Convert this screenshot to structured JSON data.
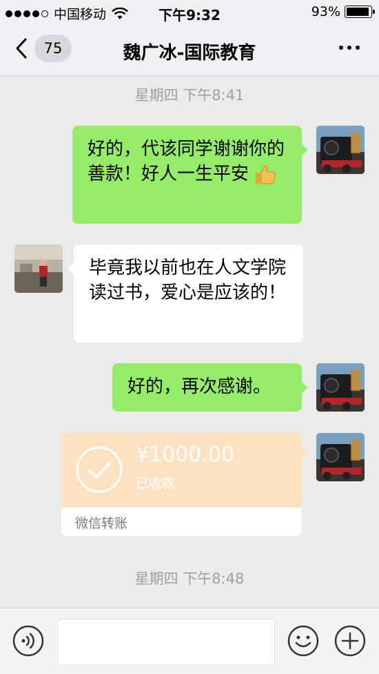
{
  "status_bar": {
    "carrier": "中国移动",
    "time": "下午9:32",
    "battery": "93%",
    "battery_level": 0.93
  },
  "nav": {
    "back_count": "75",
    "title": "魏广冰-国际教育"
  },
  "messages": {
    "time1": "星期四 下午8:41",
    "msg1": "好的，代该同学谢谢你的善款！好人一生平安",
    "msg2": "毕竟我以前也在人文学院读过书，爱心是应该的！",
    "msg3": "好的，再次感谢。",
    "transfer_amount": "¥1000.00",
    "transfer_status": "已收款",
    "transfer_label": "微信转账",
    "time2": "星期四 下午8:48"
  },
  "input": {
    "value": ""
  },
  "colors": {
    "green_bubble": "#95ec69",
    "transfer_bg": "#fde1c3"
  }
}
